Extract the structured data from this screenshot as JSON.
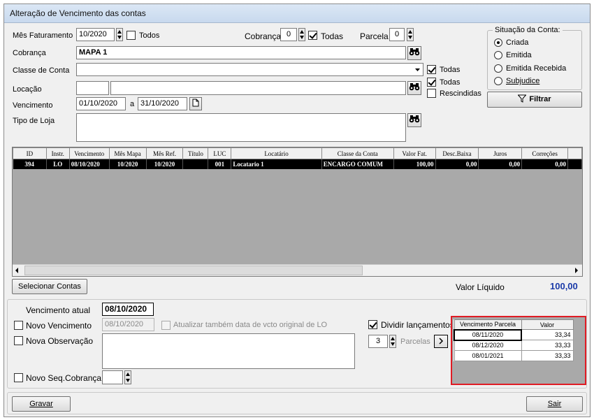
{
  "window": {
    "title": "Alteração de Vencimento das contas"
  },
  "filters": {
    "mes_faturamento_label": "Mês Faturamento",
    "mes_faturamento_value": "10/2020",
    "todos_label": "Todos",
    "cobranca_count_label": "Cobrança",
    "cobranca_count_value": "0",
    "todas_label": "Todas",
    "parcela_label": "Parcela",
    "parcela_value": "0",
    "cobranca_label": "Cobrança",
    "cobranca_value": "MAPA 1",
    "classe_label": "Classe de Conta",
    "classe_value": "",
    "classe_todas_label": "Todas",
    "locacao_label": "Locação",
    "locacao_code": "",
    "locacao_name": "",
    "locacao_todas_label": "Todas",
    "rescindidas_label": "Rescindidas",
    "vencimento_label": "Vencimento",
    "vencimento_from": "01/10/2020",
    "vencimento_sep": "a",
    "vencimento_to": "31/10/2020",
    "tipo_loja_label": "Tipo de Loja",
    "tipo_loja_value": ""
  },
  "situacao": {
    "title": "Situação da Conta:",
    "options": [
      "Criada",
      "Emitida",
      "Emitida Recebida",
      "Subjudice"
    ],
    "selected": "Criada",
    "filtrar_label": "Filtrar"
  },
  "grid": {
    "columns": [
      "ID",
      "Instr.",
      "Vencimento",
      "Mês Mapa",
      "Mês Ref.",
      "Título",
      "LUC",
      "Locatário",
      "Classe da Conta",
      "Valor Fat.",
      "Desc.Baixa",
      "Juros",
      "Correções"
    ],
    "rows": [
      [
        "394",
        "LO",
        "08/10/2020",
        "10/2020",
        "10/2020",
        "",
        "001",
        "Locatario 1",
        "ENCARGO COMUM",
        "100,00",
        "0,00",
        "0,00",
        "0,00"
      ]
    ]
  },
  "summary": {
    "selecionar_label": "Selecionar Contas",
    "valor_liquido_label": "Valor Líquido",
    "valor_liquido_value": "100,00"
  },
  "edit": {
    "vencimento_atual_label": "Vencimento atual",
    "vencimento_atual_value": "08/10/2020",
    "novo_vencimento_label": "Novo Vencimento",
    "novo_vencimento_value": "08/10/2020",
    "atualizar_label": "Atualizar também data de vcto original de LO",
    "nova_observacao_label": "Nova Observação",
    "nova_observacao_value": "",
    "novo_seq_label": "Novo Seq.Cobrança",
    "novo_seq_value": "",
    "dividir_label": "Dividir lançamentos",
    "parcelas_value": "3",
    "parcelas_label": "Parcelas",
    "parcelas_columns": [
      "Vencimento Parcela",
      "Valor"
    ],
    "parcelas_rows": [
      [
        "08/11/2020",
        "33,34"
      ],
      [
        "08/12/2020",
        "33,33"
      ],
      [
        "08/01/2021",
        "33,33"
      ]
    ]
  },
  "footer": {
    "gravar_label": "Gravar",
    "sair_label": "Sair"
  },
  "colors": {
    "accent_value": "#1a3aa8",
    "highlight_border": "#e01b24",
    "selected_row": "#000000"
  }
}
